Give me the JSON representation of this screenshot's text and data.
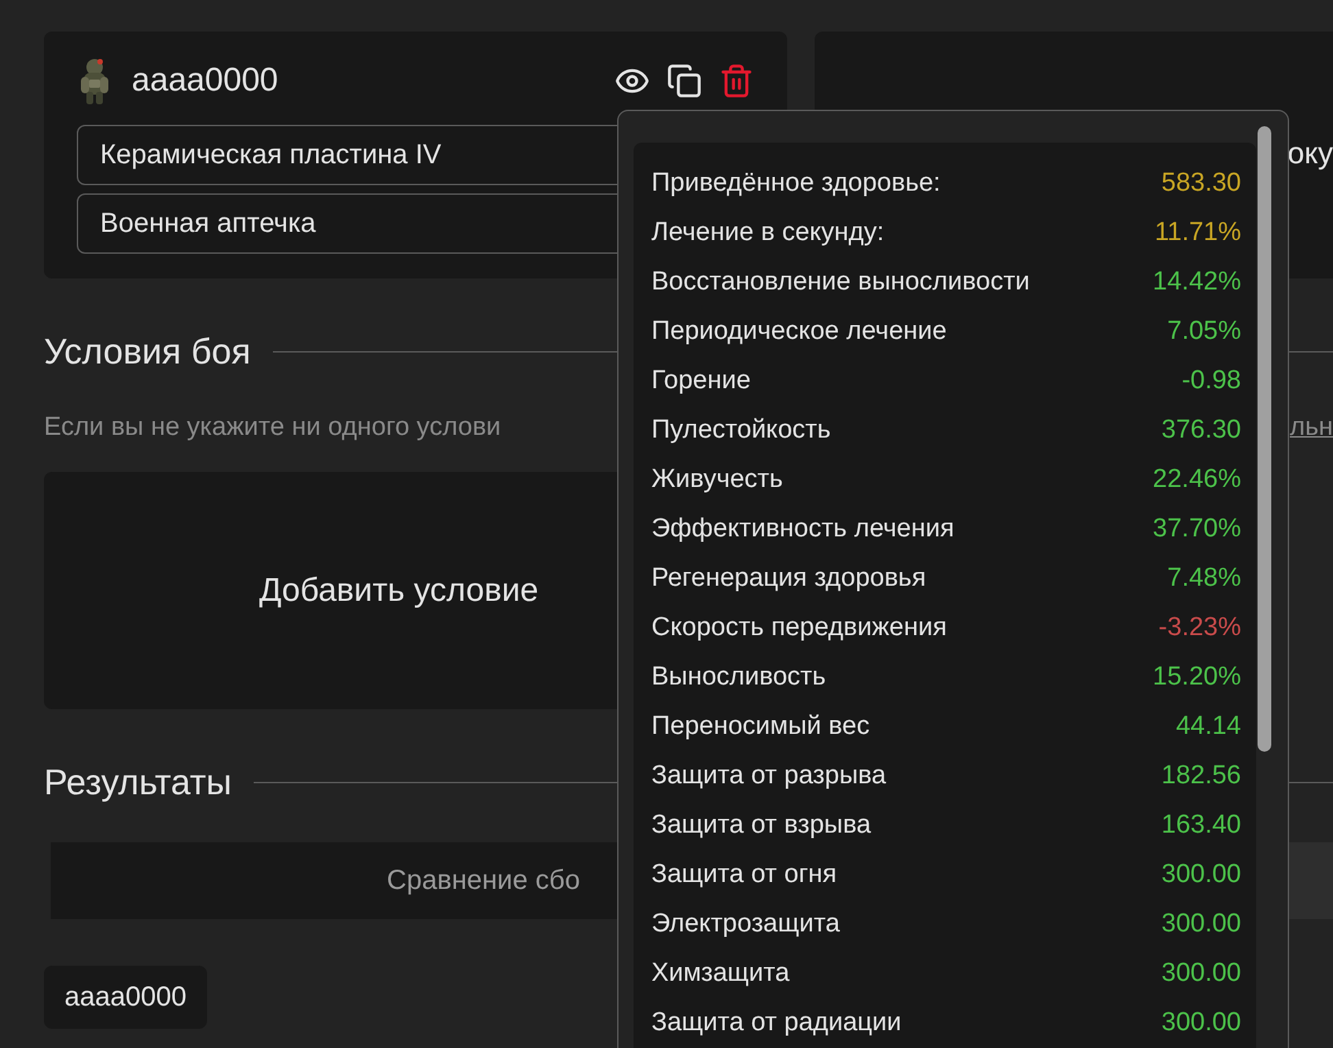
{
  "build_card": {
    "name": "aaaa0000",
    "items": [
      "Керамическая пластина IV",
      "Военная аптечка"
    ]
  },
  "right_card": {
    "text": "оку"
  },
  "conditions": {
    "title": "Условия боя",
    "hint": "Если вы не укажите ни одного услови",
    "hint_link": "льн",
    "add_button": "Добавить условие"
  },
  "results": {
    "title": "Результаты",
    "comparison": "Сравнение сбо",
    "tag": "aaaa0000"
  },
  "stats_popup": {
    "stats": [
      {
        "label": "Приведённое здоровье:",
        "value": "583.30",
        "color": "#c9a624"
      },
      {
        "label": "Лечение в секунду:",
        "value": "11.71%",
        "color": "#c9a624"
      },
      {
        "label": "Восстановление выносливости",
        "value": "14.42%",
        "color": "#4cc24a"
      },
      {
        "label": "Периодическое лечение",
        "value": "7.05%",
        "color": "#4cc24a"
      },
      {
        "label": "Горение",
        "value": "-0.98",
        "color": "#4cc24a"
      },
      {
        "label": "Пулестойкость",
        "value": "376.30",
        "color": "#4cc24a"
      },
      {
        "label": "Живучесть",
        "value": "22.46%",
        "color": "#4cc24a"
      },
      {
        "label": "Эффективность лечения",
        "value": "37.70%",
        "color": "#4cc24a"
      },
      {
        "label": "Регенерация здоровья",
        "value": "7.48%",
        "color": "#4cc24a"
      },
      {
        "label": "Скорость передвижения",
        "value": "-3.23%",
        "color": "#c94b4b"
      },
      {
        "label": "Выносливость",
        "value": "15.20%",
        "color": "#4cc24a"
      },
      {
        "label": "Переносимый вес",
        "value": "44.14",
        "color": "#4cc24a"
      },
      {
        "label": "Защита от разрыва",
        "value": "182.56",
        "color": "#4cc24a"
      },
      {
        "label": "Защита от взрыва",
        "value": "163.40",
        "color": "#4cc24a"
      },
      {
        "label": "Защита от огня",
        "value": "300.00",
        "color": "#4cc24a"
      },
      {
        "label": "Электрозащита",
        "value": "300.00",
        "color": "#4cc24a"
      },
      {
        "label": "Химзащита",
        "value": "300.00",
        "color": "#4cc24a"
      },
      {
        "label": "Защита от радиации",
        "value": "300.00",
        "color": "#4cc24a"
      }
    ]
  }
}
